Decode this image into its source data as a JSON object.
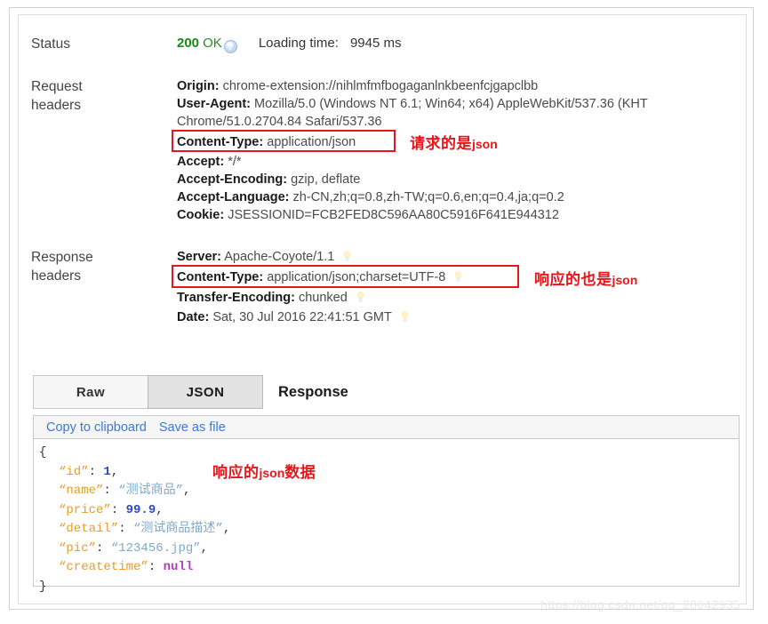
{
  "status": {
    "label": "Status",
    "code": "200",
    "text": "OK",
    "help_icon": "question-mark-icon",
    "loading_label": "Loading time:",
    "loading_value": "9945 ms"
  },
  "request_headers": {
    "label": "Request\nheaders",
    "items": [
      {
        "name": "Origin",
        "value": "chrome-extension://nihlmfmfbogaganlnkbeenfcjgapclbb"
      },
      {
        "name": "User-Agent",
        "value": "Mozilla/5.0 (Windows NT 6.1; Win64; x64) AppleWebKit/537.36 (KHT"
      },
      {
        "name": "",
        "value": "Chrome/51.0.2704.84 Safari/537.36"
      },
      {
        "name": "Content-Type",
        "value": "application/json"
      },
      {
        "name": "Accept",
        "value": "*/*"
      },
      {
        "name": "Accept-Encoding",
        "value": "gzip, deflate"
      },
      {
        "name": "Accept-Language",
        "value": "zh-CN,zh;q=0.8,zh-TW;q=0.6,en;q=0.4,ja;q=0.2"
      },
      {
        "name": "Cookie",
        "value": "JSESSIONID=FCB2FED8C596AA80C5916F641E944312"
      }
    ]
  },
  "response_headers": {
    "label": "Response\nheaders",
    "items": [
      {
        "name": "Server",
        "value": "Apache-Coyote/1.1",
        "bulb": true
      },
      {
        "name": "Content-Type",
        "value": "application/json;charset=UTF-8",
        "bulb": true
      },
      {
        "name": "Transfer-Encoding",
        "value": "chunked",
        "bulb": true
      },
      {
        "name": "Date",
        "value": "Sat, 30 Jul 2016 22:41:51 GMT",
        "bulb": true
      }
    ]
  },
  "annotations": {
    "request_json": {
      "cn": "请求的是",
      "en": "json"
    },
    "response_json": {
      "cn": "响应的也是",
      "en": "json"
    },
    "body_json": {
      "cn_pre": "响应的",
      "en": "json",
      "cn_post": "数据"
    }
  },
  "tabs": {
    "raw": "Raw",
    "json": "JSON",
    "active": "JSON",
    "response_title": "Response"
  },
  "json_viewer": {
    "copy_label": "Copy to clipboard",
    "save_label": "Save as file",
    "open_brace": "{",
    "close_brace": "}",
    "entries": [
      {
        "key": "“id”",
        "colon": ":",
        "value": "1",
        "type": "num",
        "comma": ","
      },
      {
        "key": "“name”",
        "colon": ":",
        "value": "“测试商品”",
        "type": "str",
        "comma": ","
      },
      {
        "key": "“price”",
        "colon": ":",
        "value": "99.9",
        "type": "num",
        "comma": ","
      },
      {
        "key": "“detail”",
        "colon": ":",
        "value": "“测试商品描述”",
        "type": "str",
        "comma": ","
      },
      {
        "key": "“pic”",
        "colon": ":",
        "value": "“123456.jpg”",
        "type": "str",
        "comma": ","
      },
      {
        "key": "“createtime”",
        "colon": ":",
        "value": "null",
        "type": "null",
        "comma": ""
      }
    ]
  },
  "watermark": "https://blog.csdn.net/qq_20042935",
  "colors": {
    "status_green": "#1a8a1a",
    "annotation_red": "#e8161a",
    "link_blue": "#3a78d8",
    "json_key": "#e89c2a",
    "json_number": "#2b49c9",
    "json_string": "#7fa8c9",
    "json_null": "#b03fc0"
  }
}
